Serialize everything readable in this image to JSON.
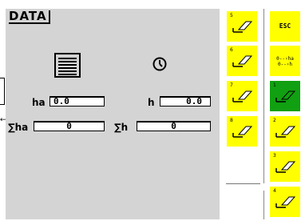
{
  "screen": {
    "title": "DATA"
  },
  "edge": {
    "arrow": "←"
  },
  "icons": {
    "area": "area-hatched-icon",
    "time": "clock-icon"
  },
  "counters": {
    "ha_label": "ha",
    "ha_value": "0.0",
    "h_label": "h",
    "h_value": "0.0",
    "total_ha_label": "∑ha",
    "total_ha_value": "0",
    "total_h_label": "∑h",
    "total_h_value": "0"
  },
  "softkeys_left": [
    {
      "number": "5",
      "icon": "eraser-icon",
      "color": "#ffff00"
    },
    {
      "number": "6",
      "icon": "eraser-icon",
      "color": "#ffff00"
    },
    {
      "number": "7",
      "icon": "eraser-icon",
      "color": "#ffff00"
    },
    {
      "number": "8",
      "icon": "eraser-icon",
      "color": "#ffff00"
    }
  ],
  "softkeys_right": [
    {
      "label": "ESC",
      "color": "#ffff00"
    },
    {
      "line1": "0--›ha",
      "line2": "0--›h",
      "color": "#ffff00"
    },
    {
      "number": "1",
      "icon": "eraser-icon",
      "color": "#11a011"
    },
    {
      "number": "2",
      "icon": "eraser-icon",
      "color": "#ffff00"
    },
    {
      "number": "3",
      "icon": "eraser-icon",
      "color": "#ffff00"
    },
    {
      "number": "4",
      "icon": "eraser-icon",
      "color": "#ffff00"
    }
  ]
}
